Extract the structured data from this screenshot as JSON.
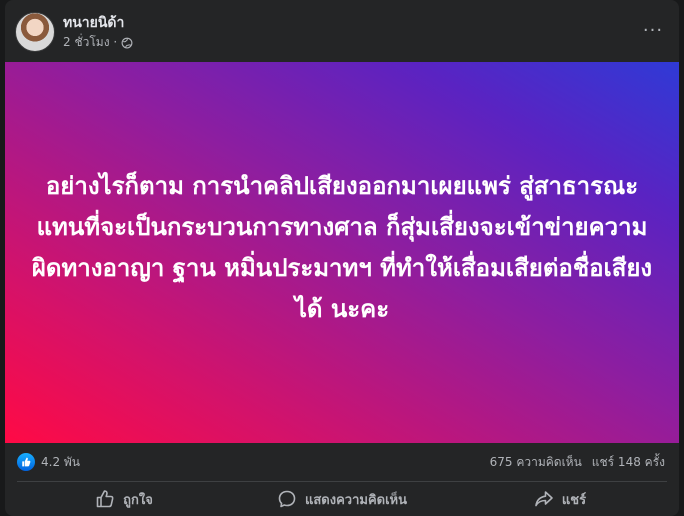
{
  "post": {
    "author": "ทนายนิด้า",
    "time": "2 ชั่วโมง ·",
    "banner_text": "อย่างไรก็ตาม การนำคลิปเสียงออกมาเผยแพร่ สู่สาธารณะ แทนที่จะเป็นกระบวนการทางศาล ก็สุ่มเสี่ยงจะเข้าข่ายความผิดทางอาญา ฐาน หมิ่นประมาทฯ ที่ทำให้เสื่อมเสียต่อชื่อเสียงได้ นะคะ",
    "more_label": "···"
  },
  "stats": {
    "reactions": "4.2 พัน",
    "comments": "675 ความคิดเห็น",
    "shares": "แชร์ 148 ครั้ง"
  },
  "actions": {
    "like": "ถูกใจ",
    "comment": "แสดงความคิดเห็น",
    "share": "แชร์"
  },
  "icons": {
    "privacy": "globe-icon",
    "more": "more-icon",
    "like_badge": "thumbs-up-icon",
    "like": "thumbs-up-icon",
    "comment": "comment-icon",
    "share": "share-icon"
  },
  "colors": {
    "background": "#242526",
    "text_primary": "#e4e6eb",
    "text_secondary": "#b0b3b8",
    "like_blue": "#0866ff",
    "gradient_start": "#ff0a45",
    "gradient_end": "#2f3ad6"
  }
}
